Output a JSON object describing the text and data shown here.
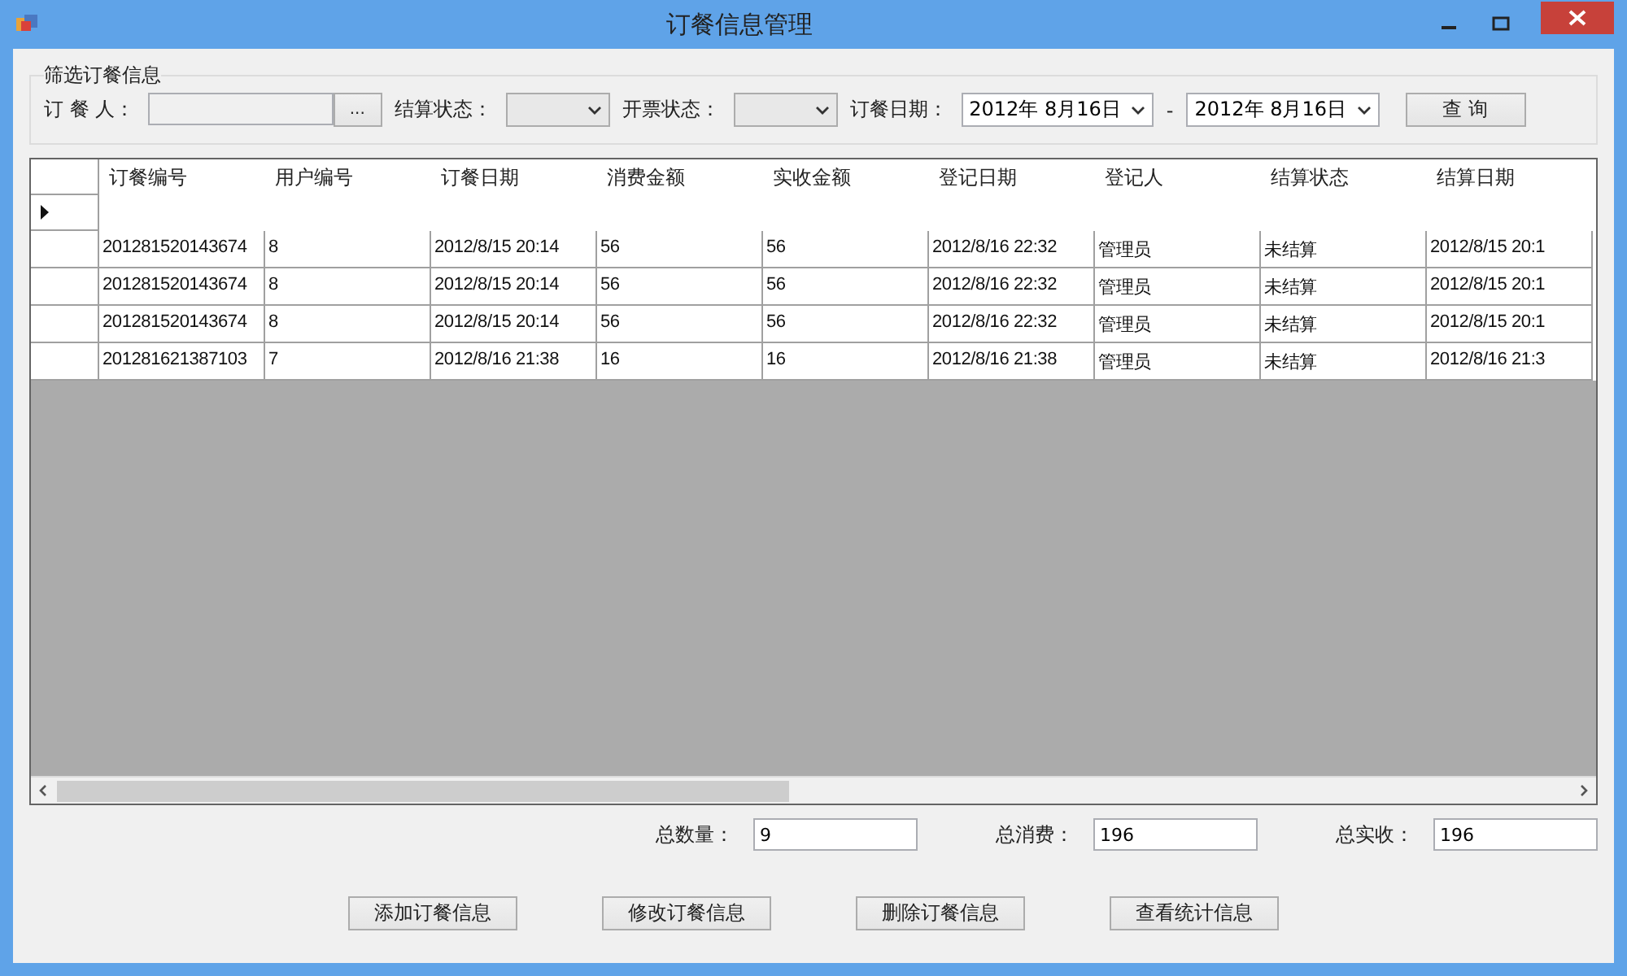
{
  "window": {
    "title": "订餐信息管理"
  },
  "filter": {
    "title": "筛选订餐信息",
    "person_label": "订 餐 人：",
    "browse_button": "...",
    "settle_label": "结算状态：",
    "invoice_label": "开票状态：",
    "date_label": "订餐日期：",
    "date_from": "2012年 8月16日",
    "date_sep": "-",
    "date_to": "2012年 8月16日",
    "query_button": "查 询"
  },
  "table": {
    "columns": [
      "订餐编号",
      "用户编号",
      "订餐日期",
      "消费金额",
      "实收金额",
      "登记日期",
      "登记人",
      "结算状态",
      "结算日期"
    ],
    "new_row": {
      "selected": true
    },
    "rows": [
      [
        "201281520143674",
        "8",
        "2012/8/15 20:14",
        "56",
        "56",
        "2012/8/16 22:32",
        "管理员",
        "未结算",
        "2012/8/15 20:1"
      ],
      [
        "201281520143674",
        "8",
        "2012/8/15 20:14",
        "56",
        "56",
        "2012/8/16 22:32",
        "管理员",
        "未结算",
        "2012/8/15 20:1"
      ],
      [
        "201281520143674",
        "8",
        "2012/8/15 20:14",
        "56",
        "56",
        "2012/8/16 22:32",
        "管理员",
        "未结算",
        "2012/8/15 20:1"
      ],
      [
        "201281621387103",
        "7",
        "2012/8/16 21:38",
        "16",
        "16",
        "2012/8/16 21:38",
        "管理员",
        "未结算",
        "2012/8/16 21:3"
      ]
    ]
  },
  "totals": [
    {
      "label": "总数量：",
      "value": "9"
    },
    {
      "label": "总消费：",
      "value": "196"
    },
    {
      "label": "总实收：",
      "value": "196"
    }
  ],
  "buttons": [
    "添加订餐信息",
    "修改订餐信息",
    "删除订餐信息",
    "查看统计信息"
  ]
}
